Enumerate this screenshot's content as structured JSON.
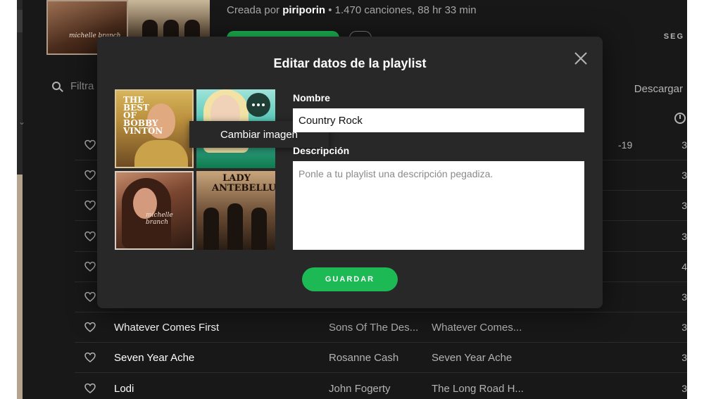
{
  "header": {
    "created_by_prefix": "Creada por",
    "owner": "piriporin",
    "stats": "• 1.470 canciones, 88 hr 33 min",
    "cover_caption": "michelle branch",
    "follow_label": "SEG"
  },
  "toolbar": {
    "filter_placeholder": "Filtra",
    "download_label": "Descargar"
  },
  "tracks": [
    {
      "title": "",
      "artist": "",
      "album": "",
      "date": "-19",
      "duration": "3"
    },
    {
      "title": "",
      "artist": "",
      "album": "",
      "date": "",
      "duration": "3"
    },
    {
      "title": "",
      "artist": "",
      "album": "",
      "date": "",
      "duration": "3"
    },
    {
      "title": "",
      "artist": "",
      "album": "",
      "date": "",
      "duration": "3"
    },
    {
      "title": "",
      "artist": "",
      "album": "",
      "date": "",
      "duration": "4"
    },
    {
      "title": "",
      "artist": "",
      "album": "",
      "date": "",
      "duration": "3"
    },
    {
      "title": "Whatever Comes First",
      "artist": "Sons Of The Des...",
      "album": "Whatever Comes...",
      "date": "",
      "duration": "3"
    },
    {
      "title": "Seven Year Ache",
      "artist": "Rosanne Cash",
      "album": "Seven Year Ache",
      "date": "",
      "duration": "3"
    },
    {
      "title": "Lodi",
      "artist": "John Fogerty",
      "album": "The Long Road H...",
      "date": "",
      "duration": "3"
    }
  ],
  "modal": {
    "title": "Editar datos de la playlist",
    "change_image_label": "Cambiar imagen",
    "name_label": "Nombre",
    "name_value": "Country Rock",
    "description_label": "Descripción",
    "description_placeholder": "Ponle a tu playlist una descripción pegadiza.",
    "save_label": "GUARDAR",
    "art": {
      "tile1_text": "THE BEST OF BOBBY VINTON",
      "tile3_text": "michelle branch",
      "tile4_text": "LADY ANTEBELLUM"
    }
  },
  "colors": {
    "accent": "#1db954",
    "modal_bg": "#282828",
    "app_bg": "#181818"
  }
}
